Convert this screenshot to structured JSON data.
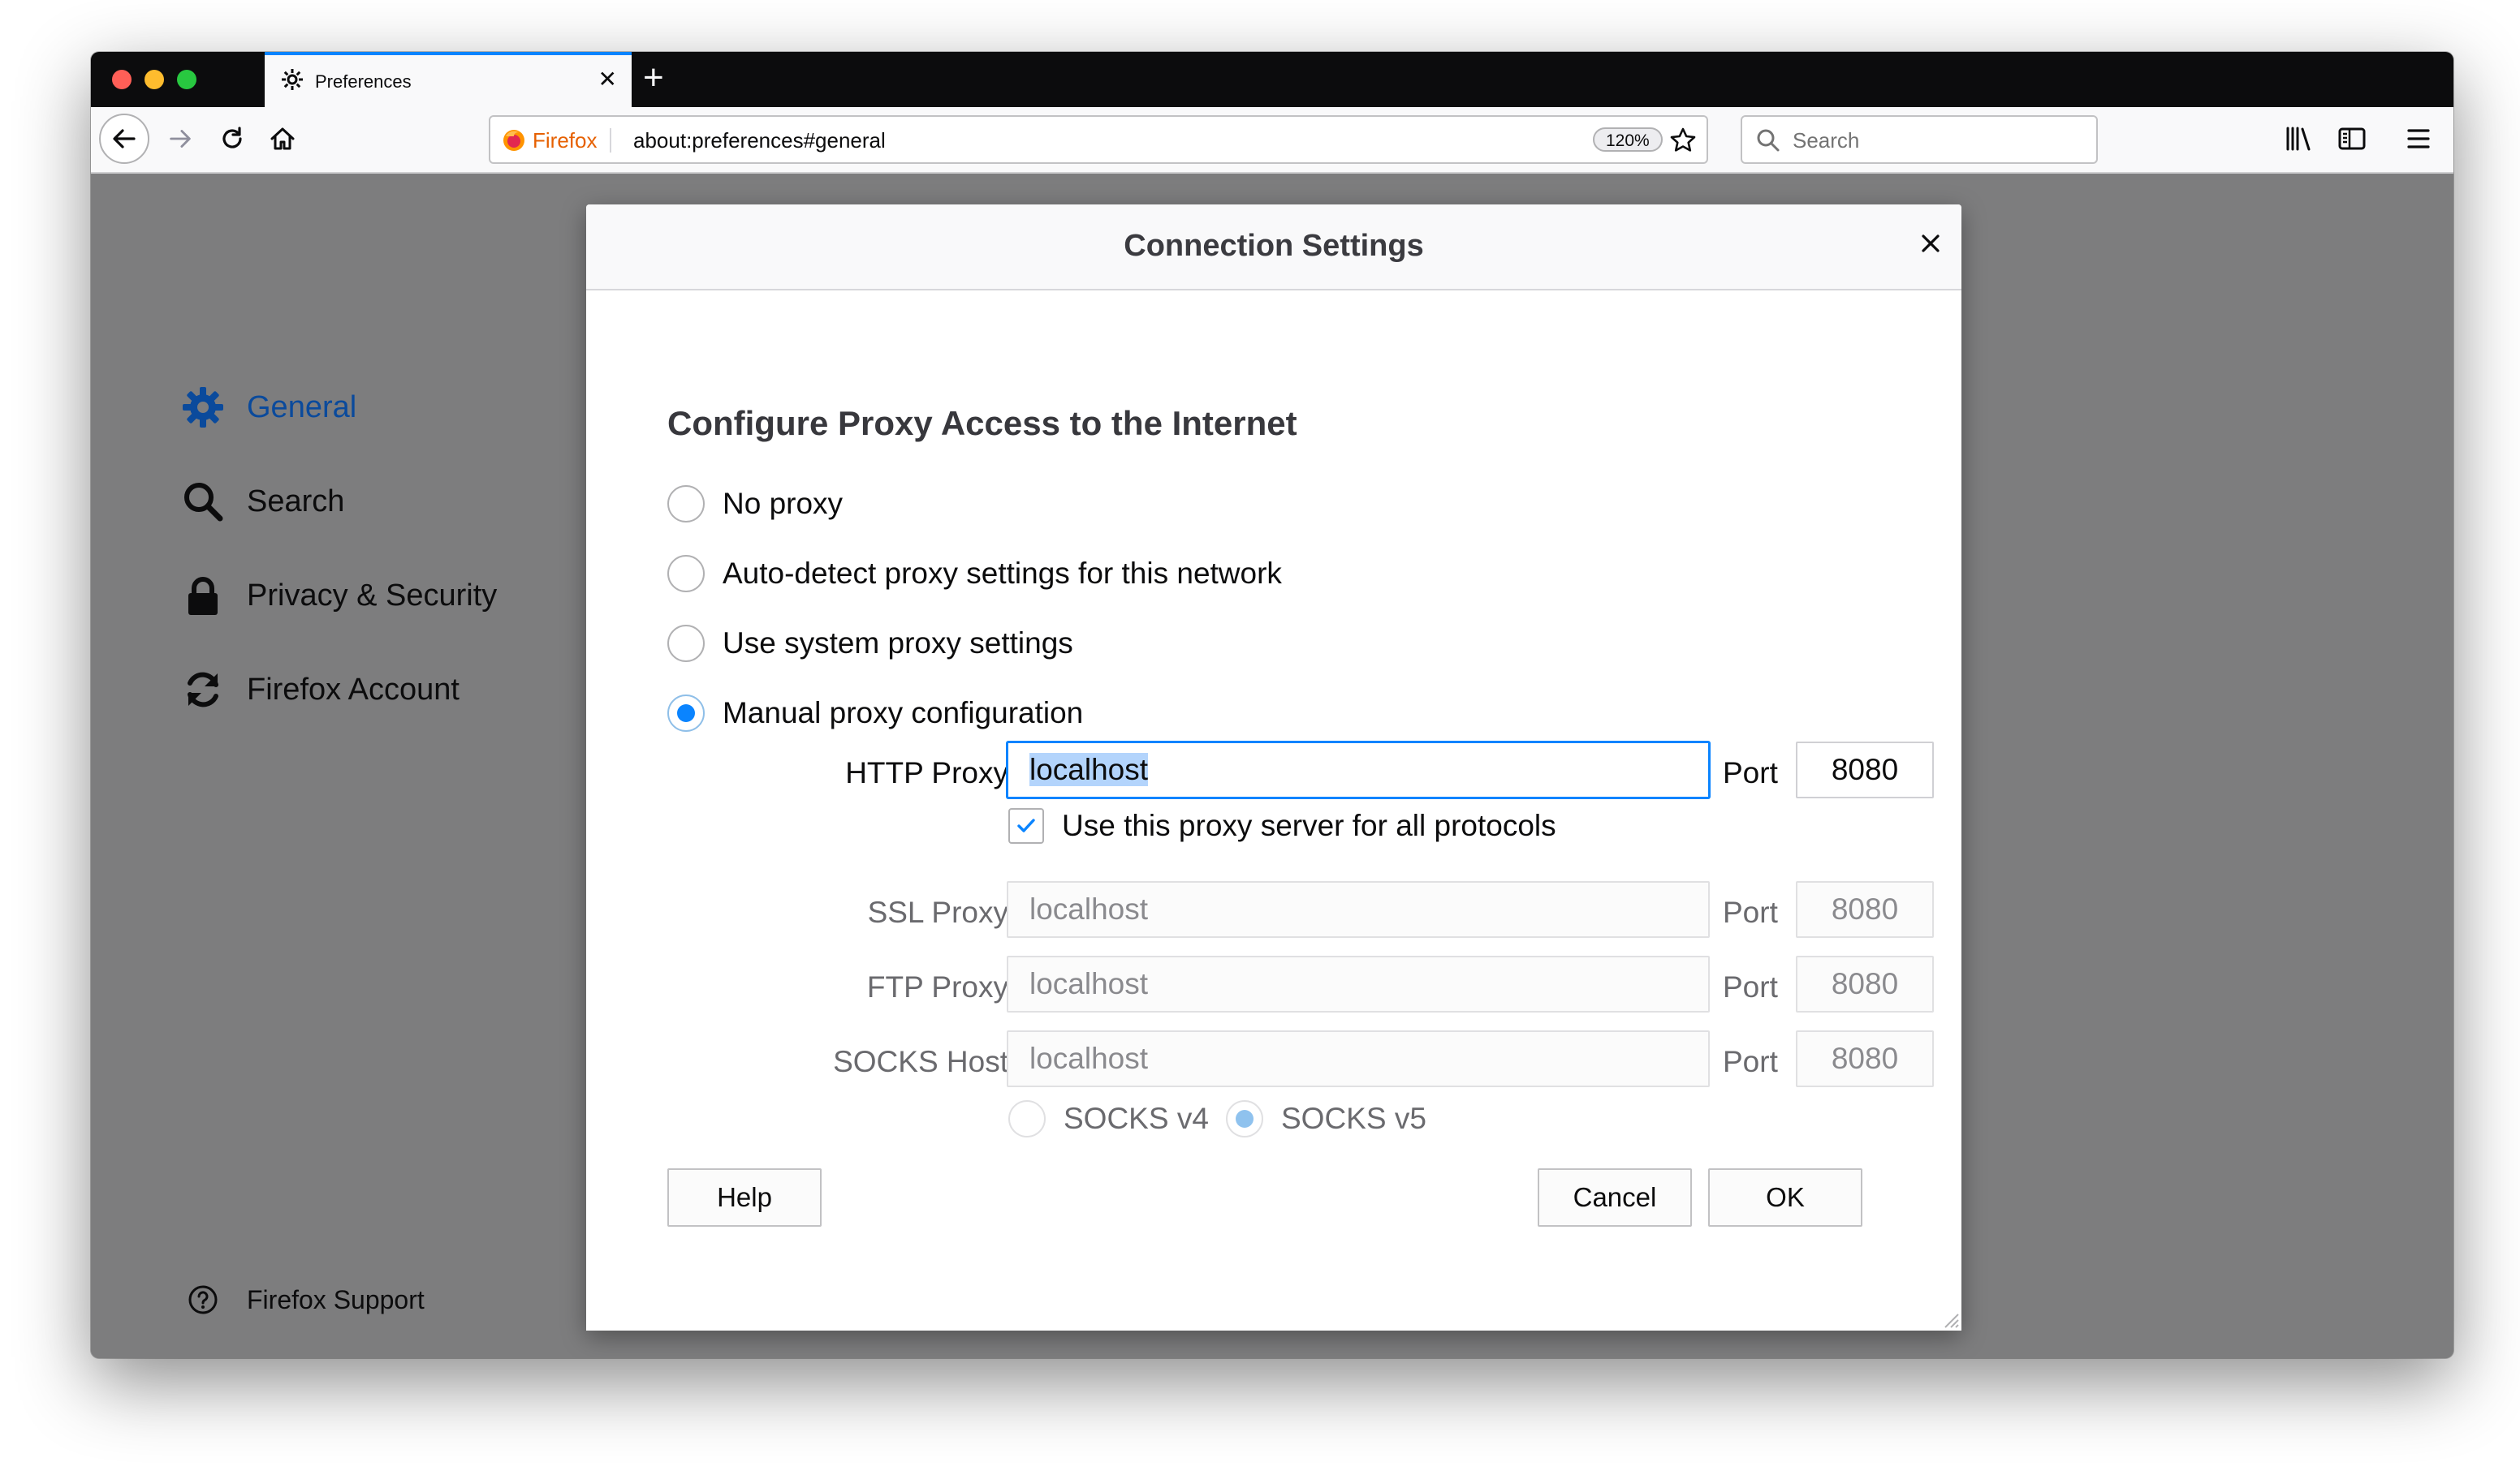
{
  "tab": {
    "title": "Preferences"
  },
  "urlbar": {
    "identity_label": "Firefox",
    "url": "about:preferences#general",
    "zoom": "120%"
  },
  "searchbar": {
    "placeholder": "Search"
  },
  "sidebar": {
    "items": [
      {
        "label": "General",
        "icon": "gear-icon",
        "active": true
      },
      {
        "label": "Search",
        "icon": "search-icon",
        "active": false
      },
      {
        "label": "Privacy & Security",
        "icon": "lock-icon",
        "active": false
      },
      {
        "label": "Firefox Account",
        "icon": "sync-icon",
        "active": false
      }
    ],
    "support_label": "Firefox Support"
  },
  "dialog": {
    "title": "Connection Settings",
    "section_title": "Configure Proxy Access to the Internet",
    "radios": [
      {
        "label": "No proxy",
        "selected": false
      },
      {
        "label": "Auto-detect proxy settings for this network",
        "selected": false
      },
      {
        "label": "Use system proxy settings",
        "selected": false
      },
      {
        "label": "Manual proxy configuration",
        "selected": true
      }
    ],
    "http_proxy": {
      "label": "HTTP Proxy",
      "value": "localhost",
      "port_label": "Port",
      "port": "8080"
    },
    "share_checkbox": {
      "label": "Use this proxy server for all protocols",
      "checked": true
    },
    "ssl_proxy": {
      "label": "SSL Proxy",
      "value": "localhost",
      "port_label": "Port",
      "port": "8080"
    },
    "ftp_proxy": {
      "label": "FTP Proxy",
      "value": "localhost",
      "port_label": "Port",
      "port": "8080"
    },
    "socks_host": {
      "label": "SOCKS Host",
      "value": "localhost",
      "port_label": "Port",
      "port": "8080"
    },
    "socks_versions": [
      {
        "label": "SOCKS v4",
        "selected": false
      },
      {
        "label": "SOCKS v5",
        "selected": true
      }
    ],
    "buttons": {
      "help": "Help",
      "cancel": "Cancel",
      "ok": "OK"
    }
  },
  "colors": {
    "accent": "#0a84ff",
    "tab_bar": "#0c0c0d",
    "overlay": "#7d7d7e",
    "firefox_orange": "#e66000"
  }
}
